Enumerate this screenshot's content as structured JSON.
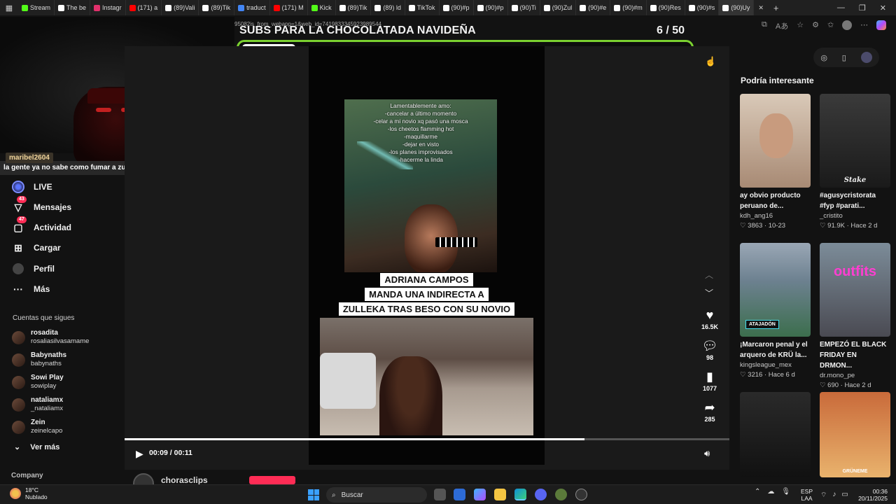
{
  "browser": {
    "tabs": [
      {
        "label": "Stream",
        "color": "#53fc18"
      },
      {
        "label": "The be",
        "color": "#ffffff"
      },
      {
        "label": "Instagr",
        "color": "#e1306c"
      },
      {
        "label": "(171) a",
        "color": "#ff0000"
      },
      {
        "label": "(89)Vali",
        "color": "#ffffff"
      },
      {
        "label": "(89)Tik",
        "color": "#ffffff"
      },
      {
        "label": "traduct",
        "color": "#4285f4"
      },
      {
        "label": "(171) M",
        "color": "#ff0000"
      },
      {
        "label": "Kick",
        "color": "#53fc18"
      },
      {
        "label": "(89)Tik",
        "color": "#ffffff"
      },
      {
        "label": "(89) ld",
        "color": "#ffffff"
      },
      {
        "label": "TikTok",
        "color": "#ffffff"
      },
      {
        "label": "(90)#p",
        "color": "#ffffff"
      },
      {
        "label": "(90)#p",
        "color": "#ffffff"
      },
      {
        "label": "(90)Ti",
        "color": "#ffffff"
      },
      {
        "label": "(90)Zul",
        "color": "#ffffff"
      },
      {
        "label": "(90)#e",
        "color": "#ffffff"
      },
      {
        "label": "(90)#m",
        "color": "#ffffff"
      },
      {
        "label": "(90)Res",
        "color": "#ffffff"
      },
      {
        "label": "(90)#s",
        "color": "#ffffff"
      },
      {
        "label": "(90)Uy",
        "color": "#ffffff"
      }
    ],
    "active_tab_close": "✕",
    "new_tab": "+",
    "url_overlay": "95082is_from_webapp=1&web_id=7419833345923989544"
  },
  "overlay": {
    "goal_title": "SUBS PARA LA CHOCOLATADA NAVIDEÑA",
    "goal_count": "6  / 50",
    "goal_progress": 0.12,
    "chat_username": "maribel2604",
    "chat_message": "la gente ya no sabe como fumar a zully"
  },
  "sidebar": {
    "nav": [
      {
        "label": "LIVE",
        "icon": "live-icon",
        "badge": ""
      },
      {
        "label": "Mensajes",
        "icon": "inbox-icon",
        "badge": "43"
      },
      {
        "label": "Actividad",
        "icon": "activity-icon",
        "badge": "47"
      },
      {
        "label": "Cargar",
        "icon": "upload-icon",
        "badge": ""
      },
      {
        "label": "Perfil",
        "icon": "profile-icon",
        "badge": ""
      },
      {
        "label": "Más",
        "icon": "more-icon",
        "badge": ""
      }
    ],
    "following_title": "Cuentas que sigues",
    "following": [
      {
        "name": "rosadita",
        "handle": "rosaliasilvasamame"
      },
      {
        "name": "Babynaths",
        "handle": "babynaths"
      },
      {
        "name": "Sowi Play",
        "handle": "sowiplay"
      },
      {
        "name": "nataliamx",
        "handle": "_nataliamx"
      },
      {
        "name": "Zein",
        "handle": "zeinelcapo"
      }
    ],
    "see_more": "Ver más",
    "company": "Company"
  },
  "video": {
    "overlay_lines": [
      "Lamentablemente amo:",
      "-cancelar a último momento",
      "-celar a mi novio xq pasó una mosca",
      "-los cheetos flamming hot",
      "-maquillarme",
      "-dejar en visto",
      "-los planes improvisados",
      "-hacerme la linda"
    ],
    "caption_lines": [
      "ADRIANA CAMPOS",
      "MANDA UNA INDIRECTA A",
      "ZULLEKA TRAS BESO CON SU NOVIO"
    ],
    "time": "00:09 / 00:11",
    "progress": 0.76,
    "likes": "16.5K",
    "comments": "98",
    "saves": "1077",
    "shares": "285",
    "author": "chorasclips"
  },
  "right": {
    "title": "Podría interesante",
    "cards": [
      {
        "title": "ay obvio producto peruano de...",
        "author": "kdh_ang16",
        "stats": "♡ 3863 · 10-23",
        "thumb_text": "",
        "bg": "linear-gradient(180deg,#d9c9b8,#a88a74)"
      },
      {
        "title": "#agusycristorata #fyp #parati...",
        "author": "_cristito",
        "stats": "♡ 91.9K · Hace 2 d",
        "thumb_text": "Stake",
        "bg": "linear-gradient(180deg,#3a3a3a,#1a1a1a)"
      },
      {
        "title": "¡Marcaron penal y el arquero de KRÜ la...",
        "author": "kingsleague_mex",
        "stats": "♡ 3216 · Hace 6 d",
        "thumb_text": "ATAJADÓN",
        "bg": "linear-gradient(180deg,#9aa7b5,#3c6e4d)"
      },
      {
        "title": "EMPEZÓ EL BLACK FRIDAY EN DRMON...",
        "author": "dr.mono_pe",
        "stats": "♡ 690 · Hace 2 d",
        "thumb_text": "outfits",
        "bg": "linear-gradient(180deg,#7c8c99,#4a4a52)"
      },
      {
        "title": "",
        "author": "",
        "stats": "",
        "thumb_text": "",
        "bg": "linear-gradient(180deg,#2a2a2a,#111)"
      },
      {
        "title": "",
        "author": "",
        "stats": "",
        "thumb_text": "GRÜNEME",
        "bg": "linear-gradient(180deg,#c96a3a,#e9b36d)"
      }
    ]
  },
  "taskbar": {
    "temp": "18°C",
    "weather": "Nublado",
    "search": "Buscar",
    "lang1": "ESP",
    "lang2": "LAA",
    "time": "00:36",
    "date": "20/11/2025"
  }
}
